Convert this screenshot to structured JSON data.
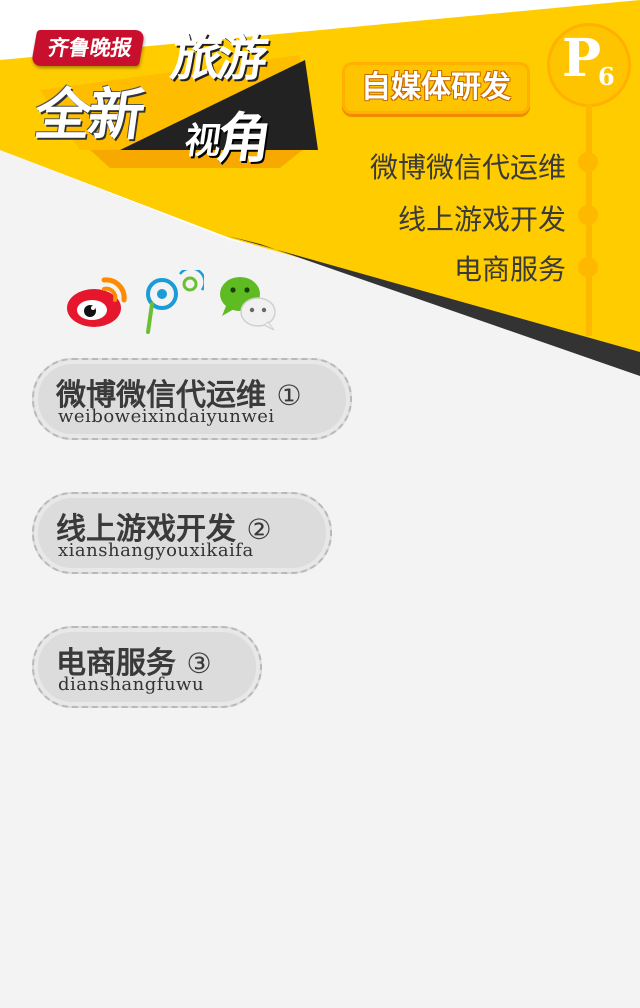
{
  "header": {
    "brand": "齐鲁晚报",
    "title_main": "全新",
    "title_travel": "旅游",
    "title_view_small": "视",
    "title_view_big": "角",
    "section_tag": "自媒体研发",
    "page_letter": "P",
    "page_number": "6"
  },
  "services_list": [
    "微博微信代运维",
    "线上游戏开发",
    "电商服务"
  ],
  "social_icons": [
    "weibo-icon",
    "qq-weibo-icon",
    "wechat-icon"
  ],
  "menu": [
    {
      "label": "微博微信代运维",
      "num": "①",
      "pinyin": "weiboweixindaiyunwei"
    },
    {
      "label": "线上游戏开发",
      "num": "②",
      "pinyin": "xianshangyouxikaifa"
    },
    {
      "label": "电商服务",
      "num": "③",
      "pinyin": "dianshangfuwu"
    }
  ],
  "colors": {
    "accent": "#ffc400",
    "brand_red": "#c8102e",
    "dark_stripe": "#333333",
    "background": "#f3f3f3"
  }
}
